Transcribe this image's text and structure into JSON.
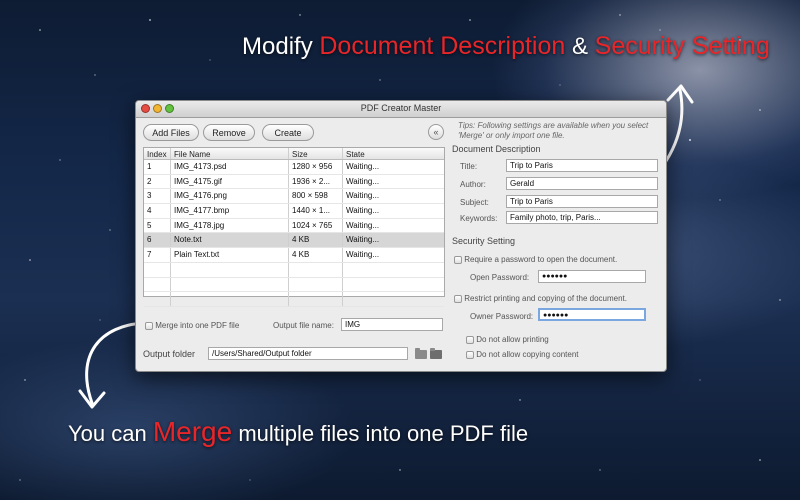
{
  "captions": {
    "top_pre": "Modify ",
    "top_accent1": "Document Description",
    "top_mid": " & ",
    "top_accent2": "Security Setting",
    "bottom_pre": "You can ",
    "bottom_accent": "Merge",
    "bottom_post": " multiple files into one PDF file"
  },
  "window": {
    "title": "PDF Creator Master"
  },
  "toolbar": {
    "add_files": "Add Files",
    "remove": "Remove",
    "create": "Create",
    "collapse_icon": "«"
  },
  "table": {
    "headers": [
      "Index",
      "File Name",
      "Size",
      "State"
    ],
    "rows": [
      [
        "1",
        "IMG_4173.psd",
        "1280 × 956",
        "Waiting..."
      ],
      [
        "2",
        "IMG_4175.gif",
        "1936 × 2...",
        "Waiting..."
      ],
      [
        "3",
        "IMG_4176.png",
        "800 × 598",
        "Waiting..."
      ],
      [
        "4",
        "IMG_4177.bmp",
        "1440 × 1...",
        "Waiting..."
      ],
      [
        "5",
        "IMG_4178.jpg",
        "1024 × 765",
        "Waiting..."
      ],
      [
        "6",
        "Note.txt",
        "4 KB",
        "Waiting..."
      ],
      [
        "7",
        "Plain Text.txt",
        "4 KB",
        "Waiting..."
      ]
    ],
    "selected_row": "6"
  },
  "merge": {
    "label": "Merge into one PDF file",
    "output_name_label": "Output file name:",
    "output_name_value": "IMG"
  },
  "output_folder": {
    "label": "Output folder",
    "value": "/Users/Shared/Output folder"
  },
  "tips": "Tips: Following settings are available when you select 'Merge' or only import one file.",
  "document_description": {
    "heading": "Document Description",
    "title_label": "Title:",
    "title_value": "Trip to Paris",
    "author_label": "Author:",
    "author_value": "Gerald",
    "subject_label": "Subject:",
    "subject_value": "Trip to Paris",
    "keywords_label": "Keywords:",
    "keywords_value": "Family photo, trip, Paris..."
  },
  "security": {
    "heading": "Security Setting",
    "require_password_label": "Require a password to open the document.",
    "open_password_label": "Open Password:",
    "open_password_value": "●●●●●●",
    "restrict_label": "Restrict printing and copying of the document.",
    "owner_password_label": "Owner Password:",
    "owner_password_value": "●●●●●●",
    "no_print_label": "Do not allow printing",
    "no_copy_label": "Do not allow copying content"
  },
  "colors": {
    "accent": "#e8262a",
    "selected_row": "#d6d6d6",
    "focus_ring": "#7aa7e0"
  }
}
